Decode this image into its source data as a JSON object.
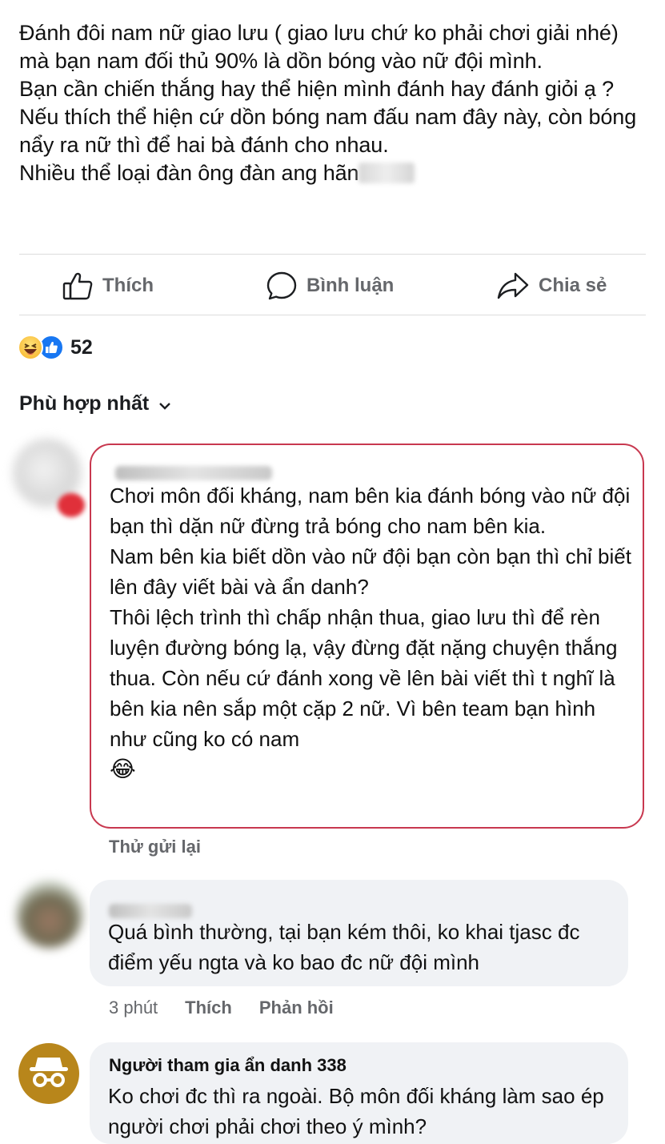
{
  "post": {
    "lines": [
      "Đánh đôi nam nữ giao lưu ( giao lưu chứ ko phải chơi giải nhé) mà bạn nam đối thủ 90% là dồn bóng vào nữ đội mình.",
      "Bạn cần chiến thắng hay thể hiện mình đánh hay đánh giỏi ạ ?",
      "Nếu thích thể hiện cứ dồn bóng nam đấu nam đây này, còn bóng nẩy ra nữ thì để hai bà đánh cho nhau."
    ],
    "last_line": "Nhiều thể loại đàn ông đàn ang hãn"
  },
  "actions": {
    "like": "Thích",
    "comment": "Bình luận",
    "share": "Chia sẻ"
  },
  "reactions": {
    "count": "52",
    "icons": [
      "haha-icon",
      "like-icon"
    ]
  },
  "sort": {
    "label": "Phù hợp nhất",
    "icon": "chevron-down-icon"
  },
  "comments": [
    {
      "lines": [
        "Chơi môn đối kháng, nam bên kia đánh bóng vào nữ đội bạn thì dặn nữ đừng trả bóng cho nam bên kia.",
        "Nam bên kia biết dồn vào nữ đội bạn còn bạn thì chỉ biết lên đây viết bài và ẩn danh?",
        "Thôi lệch trình thì chấp nhận thua, giao lưu thì để rèn luyện đường bóng lạ, vậy đừng đặt nặng chuyện thắng thua. Còn nếu cứ đánh xong về lên bài viết thì t nghĩ là bên kia nên sắp một cặp 2 nữ. Vì bên team bạn hình như cũng ko có nam"
      ],
      "emoji": "😂",
      "retry": "Thử gửi lại",
      "highlight_color": "#c8384f"
    },
    {
      "text": "Quá bình thường, tại bạn kém thôi, ko khai tjasc đc điểm yếu ngta và ko bao đc nữ đội mình",
      "time": "3 phút",
      "like": "Thích",
      "reply": "Phản hồi"
    },
    {
      "author": "Người tham gia ẩn danh 338",
      "text": "Ko chơi đc thì ra ngoài. Bộ môn đối kháng làm sao ép người chơi phải chơi theo ý mình?",
      "avatar_icon": "anonymous-icon",
      "avatar_color": "#b8861b"
    }
  ]
}
